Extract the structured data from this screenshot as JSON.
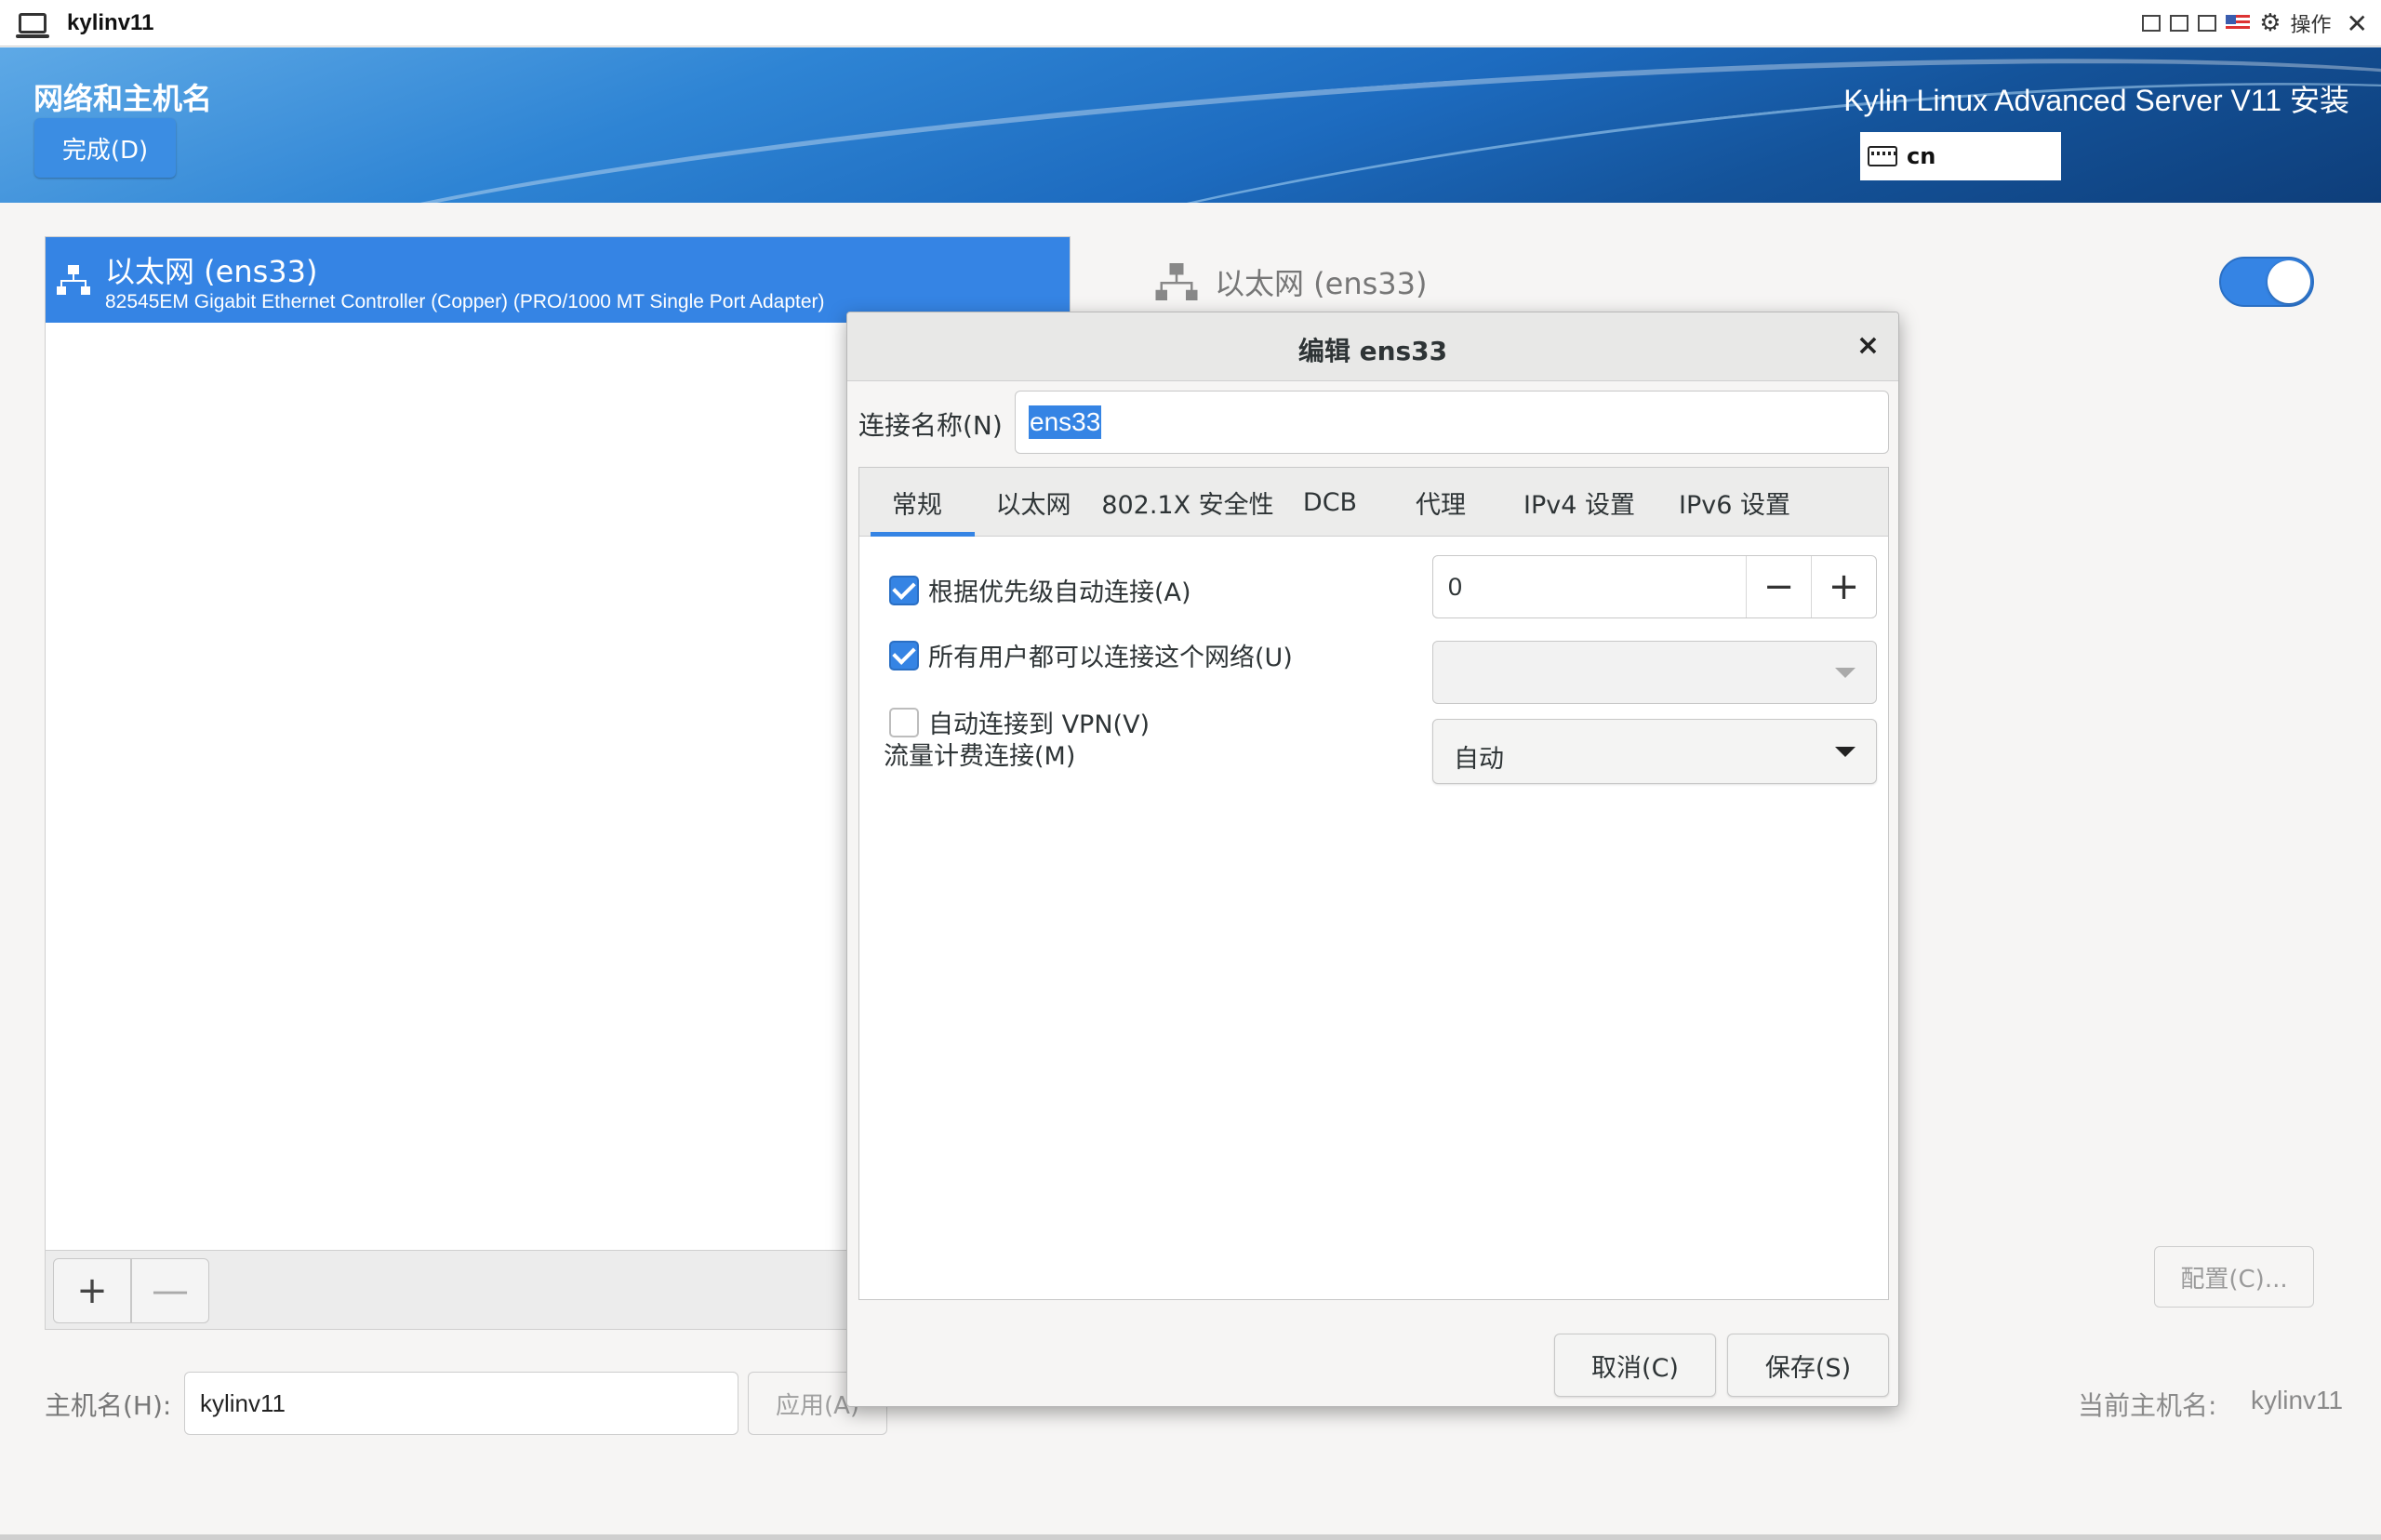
{
  "vm": {
    "title": "kylinv11",
    "actions_label": "操作"
  },
  "header": {
    "page_title": "网络和主机名",
    "done_button": "完成(D)",
    "product_title": "Kylin Linux Advanced Server V11 安装",
    "keyboard_layout": "cn"
  },
  "devices": [
    {
      "name": "以太网 (ens33)",
      "description": "82545EM Gigabit Ethernet Controller (Copper) (PRO/1000 MT Single Port Adapter)",
      "selected": true
    }
  ],
  "device_list_tools": {
    "add": "+",
    "remove": "—"
  },
  "detail": {
    "device_title": "以太网 (ens33)",
    "enabled": true,
    "configure_button": "配置(C)..."
  },
  "hostname": {
    "label": "主机名(H):",
    "value": "kylinv11",
    "apply_button": "应用(A)",
    "current_label": "当前主机名:",
    "current_value": "kylinv11"
  },
  "dialog": {
    "title": "编辑 ens33",
    "close": "×",
    "connection_name_label": "连接名称(N)",
    "connection_name_value": "ens33",
    "tabs": [
      {
        "label": "常规",
        "active": true
      },
      {
        "label": "以太网",
        "active": false
      },
      {
        "label": "802.1X 安全性",
        "active": false
      },
      {
        "label": "DCB",
        "active": false
      },
      {
        "label": "代理",
        "active": false
      },
      {
        "label": "IPv4 设置",
        "active": false
      },
      {
        "label": "IPv6 设置",
        "active": false
      }
    ],
    "general": {
      "auto_connect_label": "根据优先级自动连接(A)",
      "auto_connect_checked": true,
      "priority_value": "0",
      "priority_minus": "−",
      "priority_plus": "+",
      "all_users_label": "所有用户都可以连接这个网络(U)",
      "all_users_checked": true,
      "vpn_label": "自动连接到 VPN(V)",
      "vpn_checked": false,
      "vpn_value": "",
      "metered_label": "流量计费连接(M)",
      "metered_value": "自动"
    },
    "cancel_button": "取消(C)",
    "save_button": "保存(S)"
  },
  "colors": {
    "accent": "#3584e4",
    "banner_dark": "#0e3e7a",
    "banner_light": "#5ea9e6"
  }
}
